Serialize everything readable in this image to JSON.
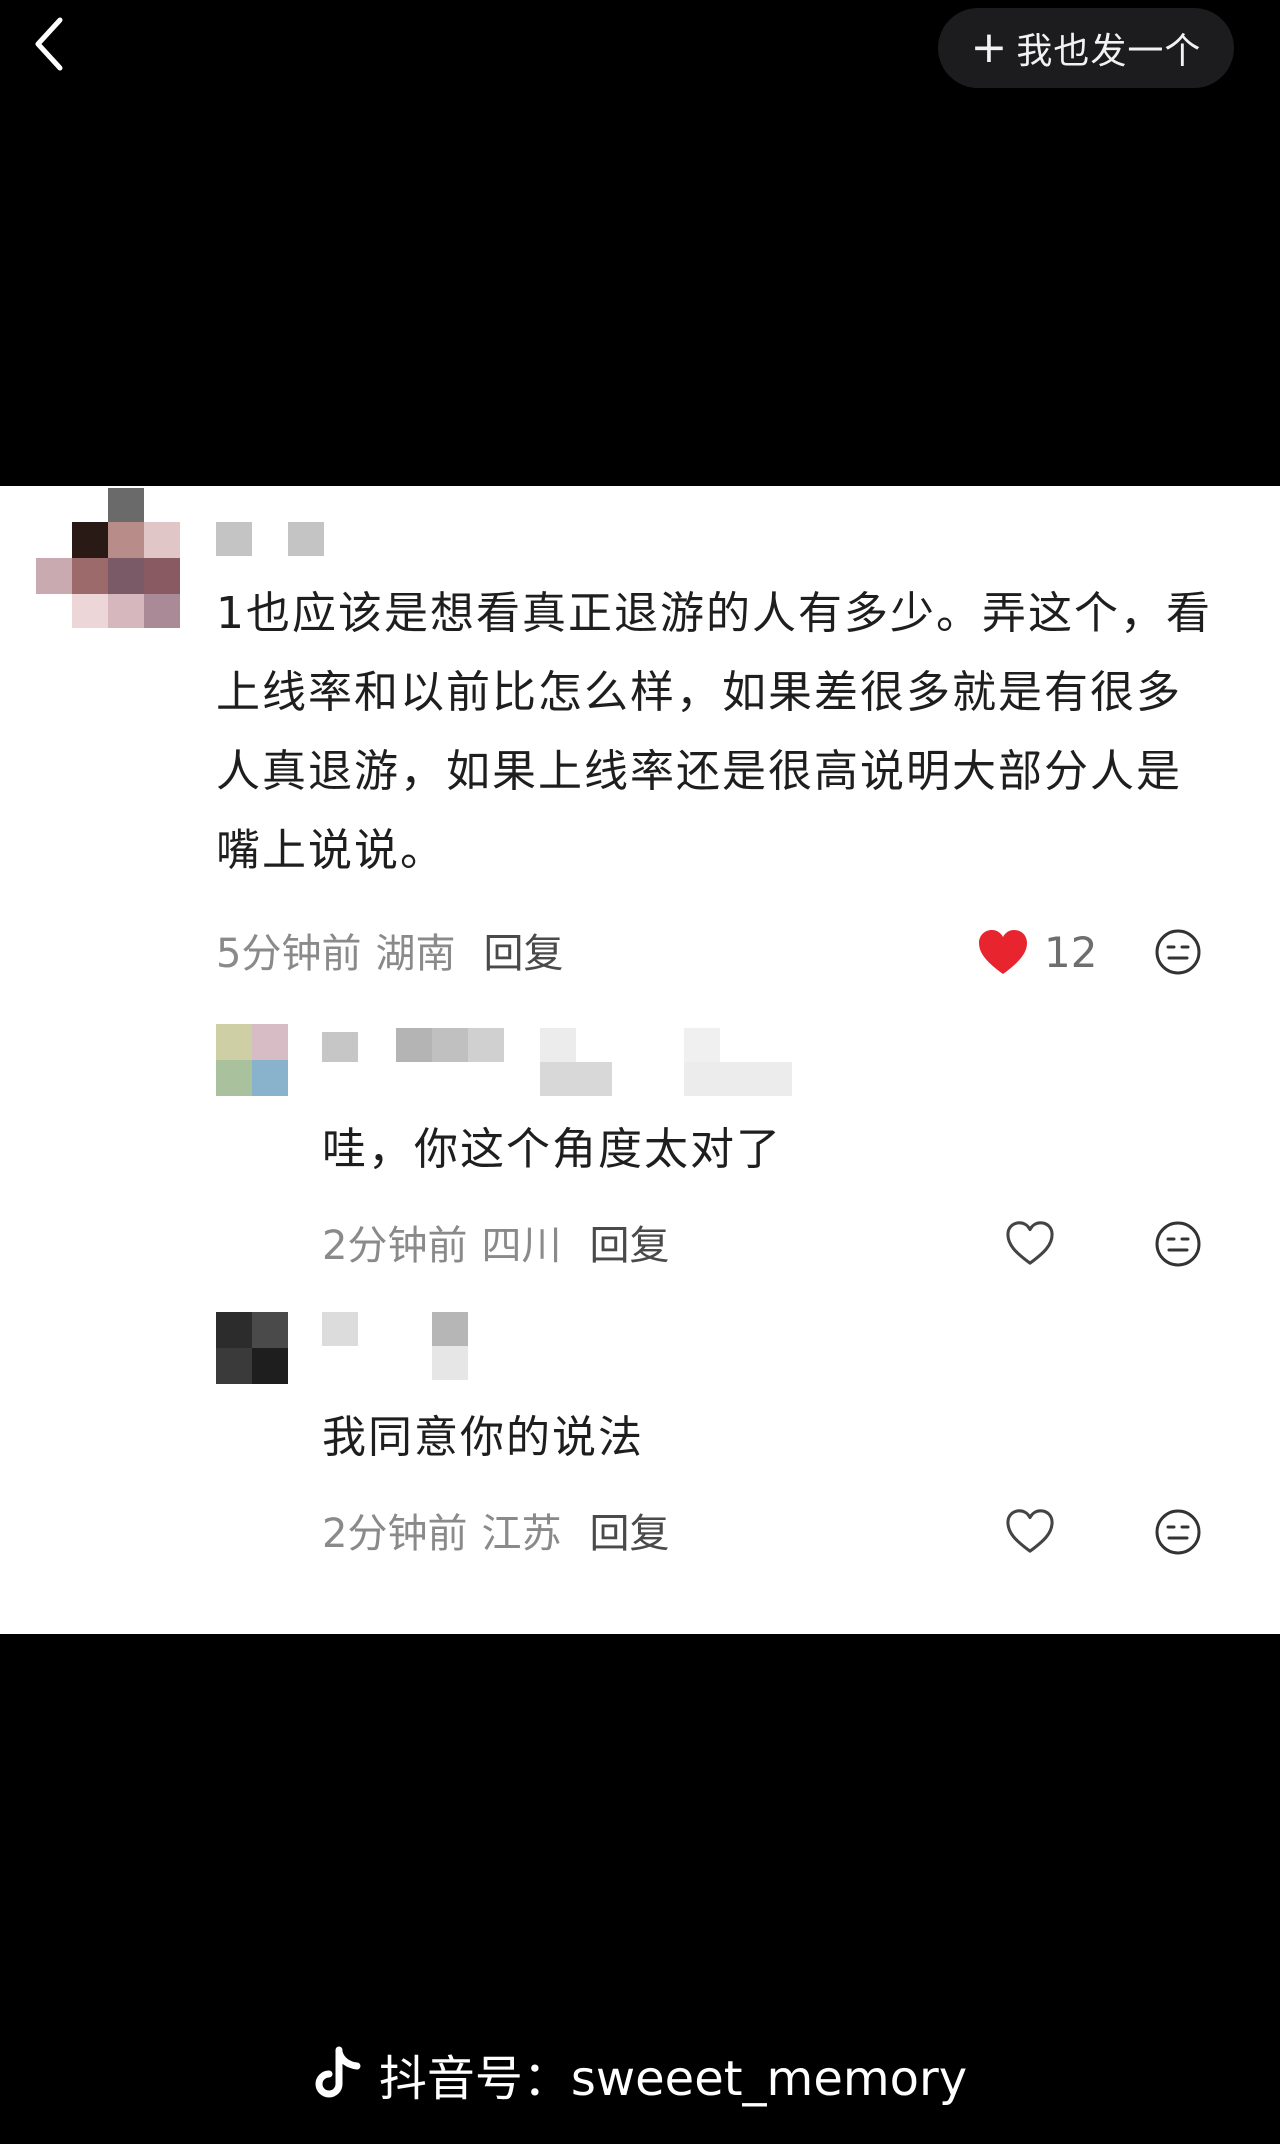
{
  "header": {
    "post_button_plus": "+",
    "post_button_label": "我也发一个"
  },
  "comments": [
    {
      "text": "1也应该是想看真正退游的人有多少。弄这个，看上线率和以前比怎么样，如果差很多就是有很多人真退游，如果上线率还是很高说明大部分人是嘴上说说。",
      "time": "5分钟前",
      "location": "湖南",
      "reply": "回复",
      "likes": "12",
      "liked": true
    },
    {
      "text": "哇，你这个角度太对了",
      "time": "2分钟前",
      "location": "四川",
      "reply": "回复",
      "liked": false
    },
    {
      "text": "我同意你的说法",
      "time": "2分钟前",
      "location": "江苏",
      "reply": "回复",
      "liked": false
    }
  ],
  "icons": {
    "back": "chevron-left-icon",
    "like_filled": "heart-filled-icon",
    "like_outline": "heart-outline-icon",
    "emoji": "emoji-icon",
    "douyin": "douyin-logo-icon"
  },
  "colors": {
    "heart": "#e8252f",
    "background": "#000000",
    "card": "#ffffff"
  },
  "footer": {
    "watermark": "抖音号：sweeet_memory"
  }
}
